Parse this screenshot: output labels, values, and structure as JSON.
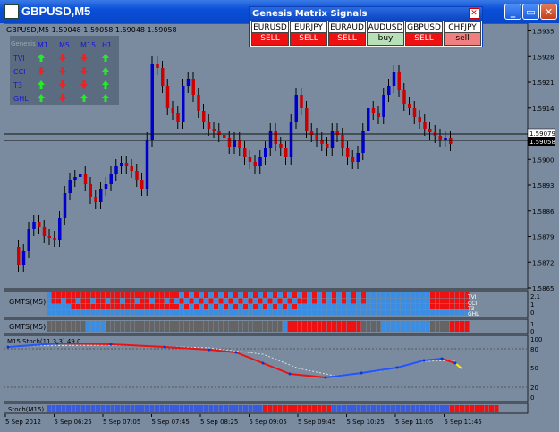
{
  "window": {
    "title": "GBPUSD,M5",
    "min_label": "_",
    "restore_label": "▭",
    "close_label": "✕"
  },
  "chart_header": "GBPUSD,M5  1.59048 1.59058 1.59048 1.59058",
  "price_axis": [
    "1.59355",
    "1.59285",
    "1.59215",
    "1.59145",
    "1.59075",
    "1.59005",
    "1.58935",
    "1.58865",
    "1.58795",
    "1.58725",
    "1.58655"
  ],
  "price_labels": {
    "line1": "1.59079",
    "line2": "1.59058"
  },
  "time_axis": [
    "5 Sep 2012",
    "5 Sep 06:25",
    "5 Sep 07:05",
    "5 Sep 07:45",
    "5 Sep 08:25",
    "5 Sep 09:05",
    "5 Sep 09:45",
    "5 Sep 10:25",
    "5 Sep 11:05",
    "5 Sep 11:45"
  ],
  "genesis_panel": {
    "title": "Genesis",
    "timeframes": [
      "M1",
      "M5",
      "M15",
      "H1"
    ],
    "rows": [
      {
        "name": "TVI",
        "arrows": [
          "up",
          "down",
          "down",
          "up"
        ]
      },
      {
        "name": "CCI",
        "arrows": [
          "down",
          "down",
          "down",
          "up"
        ]
      },
      {
        "name": "T3",
        "arrows": [
          "up",
          "down",
          "down",
          "up"
        ]
      },
      {
        "name": "GHL",
        "arrows": [
          "up",
          "down",
          "up",
          "up"
        ]
      }
    ]
  },
  "signals_window": {
    "title": "Genesis Matrix Signals",
    "close_label": "✕",
    "pairs": [
      {
        "pair": "EURUSD",
        "signal": "SELL",
        "style": "sell"
      },
      {
        "pair": "EURJPY",
        "signal": "SELL",
        "style": "sell"
      },
      {
        "pair": "EURAUD",
        "signal": "SELL",
        "style": "sell"
      },
      {
        "pair": "AUDUSD",
        "signal": "buy",
        "style": "buy"
      },
      {
        "pair": "GBPUSD",
        "signal": "SELL",
        "style": "sell"
      },
      {
        "pair": "CHFJPY",
        "signal": "sell",
        "style": "sell-weak"
      }
    ]
  },
  "gmts1": {
    "label": "GMTS(M5)",
    "axis": [
      "2.1",
      "1",
      "0"
    ],
    "row_labels": [
      "TVI",
      "CCI",
      "T3",
      "GHL"
    ]
  },
  "gmts2": {
    "label": "GMTS(M5)",
    "axis": [
      "1",
      "0"
    ]
  },
  "stoch": {
    "label": "M15 Stoch(11,3,3)  49.0",
    "axis": [
      "100",
      "80",
      "50",
      "20",
      "0"
    ]
  },
  "stoch2": {
    "label": "Stoch(M15)"
  },
  "colors": {
    "bull": "#0000cc",
    "bear": "#cc0000",
    "bg": "#7a8ba0",
    "cell_blue": "#3a8de0",
    "cell_red": "#ee1111",
    "cell_grey": "#646464",
    "buy_bg": "#b8e0b8",
    "sell_bg": "#ee1111",
    "sell_weak_bg": "#f08080"
  }
}
